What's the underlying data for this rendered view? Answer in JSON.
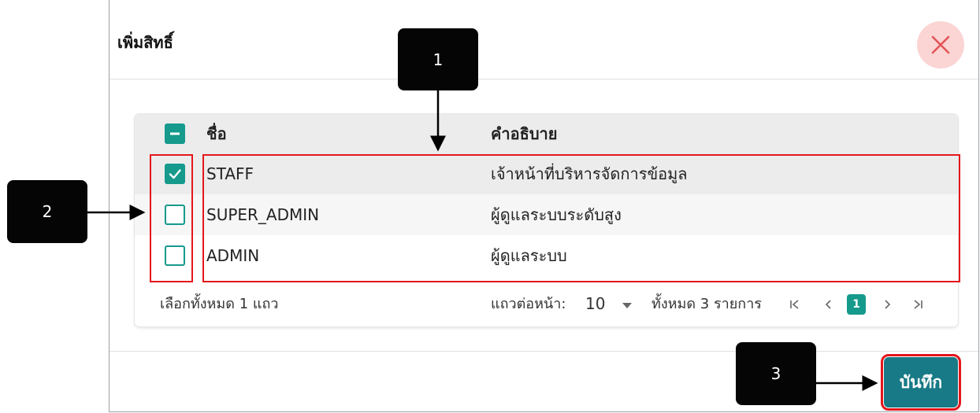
{
  "dialog": {
    "title": "เพิ่มสิทธิ์",
    "close_icon": "close-icon",
    "save_label": "บันทึก"
  },
  "table": {
    "columns": [
      "ชื่อ",
      "คำอธิบาย"
    ],
    "rows": [
      {
        "name": "STAFF",
        "description": "เจ้าหน้าที่บริหารจัดการข้อมูล",
        "checked": true
      },
      {
        "name": "SUPER_ADMIN",
        "description": "ผู้ดูแลระบบระดับสูง",
        "checked": false
      },
      {
        "name": "ADMIN",
        "description": "ผู้ดูแลระบบ",
        "checked": false
      }
    ],
    "header_checkbox": "indeterminate",
    "footer": {
      "selected_text": "เลือกทั้งหมด 1 แถว",
      "rows_per_page_label": "แถวต่อหน้า:",
      "rows_per_page_value": "10",
      "total_text": "ทั้งหมด 3 รายการ",
      "current_page": "1"
    }
  },
  "callouts": {
    "one": "1",
    "two": "2",
    "three": "3"
  },
  "colors": {
    "accent": "#159a8c",
    "save_button": "#177a86",
    "highlight": "#e4161b",
    "close_bg": "#fbd4d4"
  }
}
